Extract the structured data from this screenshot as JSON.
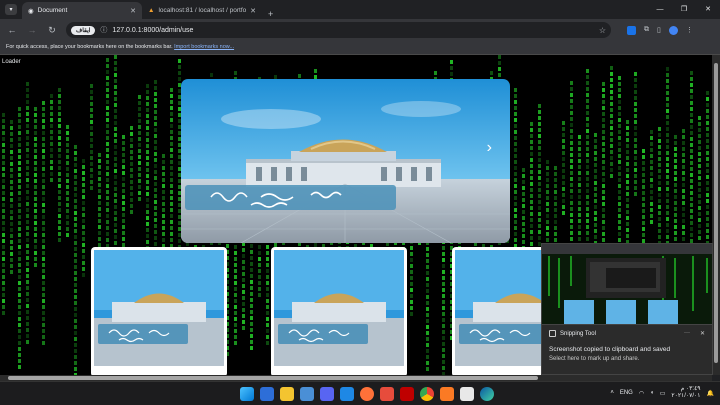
{
  "browser": {
    "tabs": [
      {
        "title": "Document",
        "active": true
      },
      {
        "title": "localhost:81 / localhost / portfo",
        "active": false
      }
    ],
    "new_tab": "+",
    "window_controls": {
      "minimize": "—",
      "maximize": "❐",
      "close": "✕"
    },
    "tab_close": "✕",
    "url_chip": "ايقاف",
    "url": "127.0.0.1:8000/admin/use",
    "bookmarks_bar": {
      "text": "For quick access, place your bookmarks here on the bookmarks bar.",
      "link": "Import bookmarks now..."
    }
  },
  "page": {
    "loader_label": "Loader",
    "hero_next": "›"
  },
  "snipping_toast": {
    "app": "Snipping Tool",
    "title": "Screenshot copied to clipboard and saved",
    "body": "Select here to mark up and share.",
    "menu": "···",
    "close": "✕"
  },
  "taskbar": {
    "lang": "ENG",
    "time": "٠٣:٤٩ م",
    "date": "٢٠٢١/٠٧/٠١"
  },
  "colors": {
    "matrix_green": "#23c227",
    "sky": "#3aa3e0",
    "dome_gold": "#c9a45a",
    "accent_blue": "#1a73e8"
  }
}
